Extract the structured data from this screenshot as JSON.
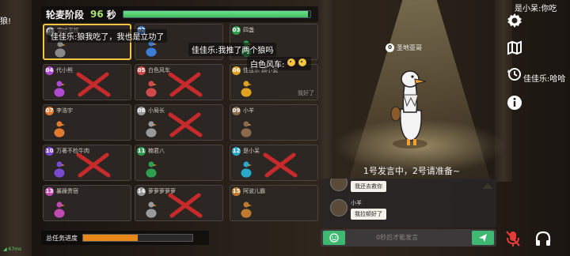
{
  "phase": {
    "name": "轮麦阶段",
    "seconds": "96",
    "unit": "秒",
    "progress": 0.99
  },
  "left_edge_text": "狼!",
  "top_right_msg": "是小呆:你吃",
  "right_msg": "佳佳乐:哈哈",
  "popups": {
    "p1": "佳佳乐:狼我吃了，我也是立功了",
    "p2": "佳佳乐:我推了两个狼吗",
    "p3": "白色风车:"
  },
  "players": [
    {
      "no": "01",
      "name": "富哈面板",
      "color": "#8a8a8a",
      "dead": false,
      "selected": true
    },
    {
      "no": "02",
      "name": "",
      "color": "#3c7bd6",
      "dead": false,
      "selected": false
    },
    {
      "no": "03",
      "name": "四盏",
      "color": "#2f9e4f",
      "dead": false,
      "selected": false
    },
    {
      "no": "04",
      "name": "代小熊",
      "color": "#b04ad0",
      "dead": true,
      "selected": false
    },
    {
      "no": "05",
      "name": "白色风车",
      "color": "#d04a4a",
      "dead": true,
      "selected": false
    },
    {
      "no": "06",
      "name": "佳佳乐·顾小瓷",
      "color": "#e0a020",
      "dead": false,
      "selected": false,
      "tag": "我好了"
    },
    {
      "no": "07",
      "name": "李浩宇",
      "color": "#e07a30",
      "dead": false,
      "selected": false
    },
    {
      "no": "08",
      "name": "小局长",
      "color": "#9a9a9a",
      "dead": true,
      "selected": false
    },
    {
      "no": "09",
      "name": "小羊",
      "color": "#8a6a4a",
      "dead": false,
      "selected": false
    },
    {
      "no": "10",
      "name": "万著不检牛肉",
      "color": "#7a4ad0",
      "dead": true,
      "selected": false
    },
    {
      "no": "11",
      "name": "楠君八",
      "color": "#2f9e4f",
      "dead": false,
      "selected": false
    },
    {
      "no": "12",
      "name": "是小呆",
      "color": "#2aa8c8",
      "dead": true,
      "selected": false
    },
    {
      "no": "13",
      "name": "暴躁贵宿",
      "color": "#c04ab0",
      "dead": false,
      "selected": false
    },
    {
      "no": "14",
      "name": "萝萝萝萝萝",
      "color": "#9a9a9a",
      "dead": true,
      "selected": false
    },
    {
      "no": "15",
      "name": "阿波儿霸",
      "color": "#c07a30",
      "dead": false,
      "selected": false
    }
  ],
  "task": {
    "label": "总任务进度",
    "progress": 0.5
  },
  "speaker": {
    "no": "0",
    "name": "圣地亚哥"
  },
  "announce": "1号发言中，2号请准备~",
  "chat": [
    {
      "name": "",
      "text": "我还去救你"
    },
    {
      "name": "小羊",
      "text": "我拉顿好了"
    }
  ],
  "input_placeholder": "0秒后才能发言",
  "ping": "67ms",
  "icons": [
    "gear-icon",
    "map-icon",
    "history-icon",
    "info-icon",
    "emoji-icon",
    "send-icon",
    "mic-muted-icon",
    "headphones-icon"
  ]
}
